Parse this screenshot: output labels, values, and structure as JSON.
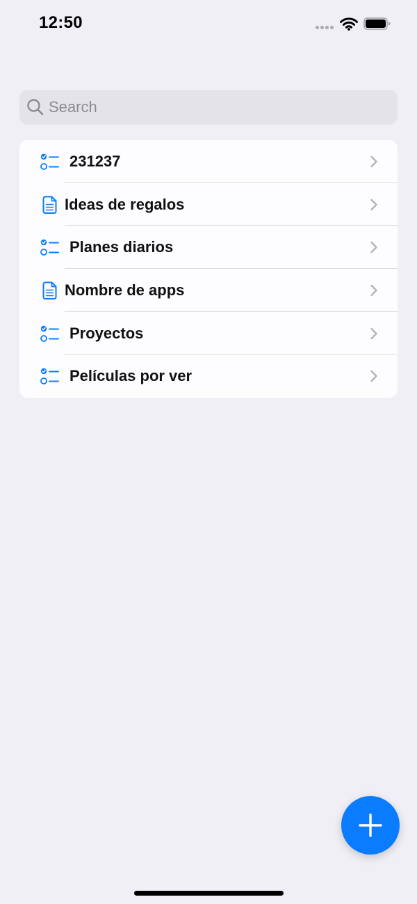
{
  "status_bar": {
    "time": "12:50"
  },
  "search": {
    "placeholder": "Search",
    "value": ""
  },
  "lists": [
    {
      "label": "231237",
      "icon": "checklist-icon"
    },
    {
      "label": "Ideas de regalos",
      "icon": "document-icon"
    },
    {
      "label": "Planes diarios",
      "icon": "checklist-icon"
    },
    {
      "label": "Nombre de apps",
      "icon": "document-icon"
    },
    {
      "label": "Proyectos",
      "icon": "checklist-icon"
    },
    {
      "label": "Películas por ver",
      "icon": "checklist-icon"
    }
  ],
  "fab": {
    "icon": "plus-icon"
  },
  "colors": {
    "accent": "#0A7CFF",
    "background": "#F0EFF5",
    "card": "#FDFCFF",
    "search_bg": "#E3E3E9"
  }
}
